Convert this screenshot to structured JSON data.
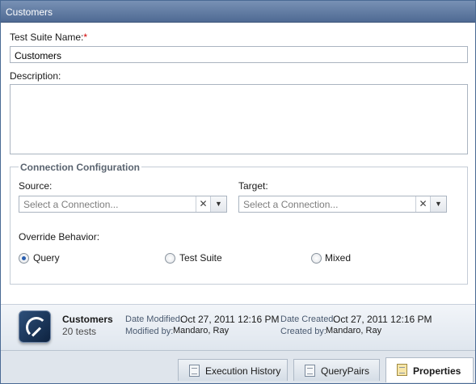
{
  "window": {
    "title": "Customers"
  },
  "form": {
    "name_label": "Test Suite Name:",
    "required_mark": "*",
    "name_value": "Customers",
    "description_label": "Description:",
    "description_value": ""
  },
  "connection": {
    "legend": "Connection Configuration",
    "source_label": "Source:",
    "source_placeholder": "Select a Connection...",
    "target_label": "Target:",
    "target_placeholder": "Select a Connection...",
    "clear_glyph": "✕",
    "dropdown_glyph": "▼"
  },
  "override": {
    "label": "Override Behavior:",
    "options": [
      "Query",
      "Test Suite",
      "Mixed"
    ],
    "selected": "Query"
  },
  "info": {
    "suite_name": "Customers",
    "test_count": "20 tests",
    "date_modified_label": "Date Modified:",
    "date_modified": "Oct 27, 2011 12:16 PM",
    "modified_by_label": "Modified by:",
    "modified_by": "Mandaro, Ray",
    "date_created_label": "Date Created:",
    "date_created": "Oct 27, 2011 12:16 PM",
    "created_by_label": "Created by:",
    "created_by": "Mandaro, Ray"
  },
  "tabs": [
    {
      "label": "Execution History",
      "icon": "document-icon",
      "active": false
    },
    {
      "label": "QueryPairs",
      "icon": "document-icon",
      "active": false
    },
    {
      "label": "Properties",
      "icon": "properties-icon",
      "active": true
    }
  ]
}
